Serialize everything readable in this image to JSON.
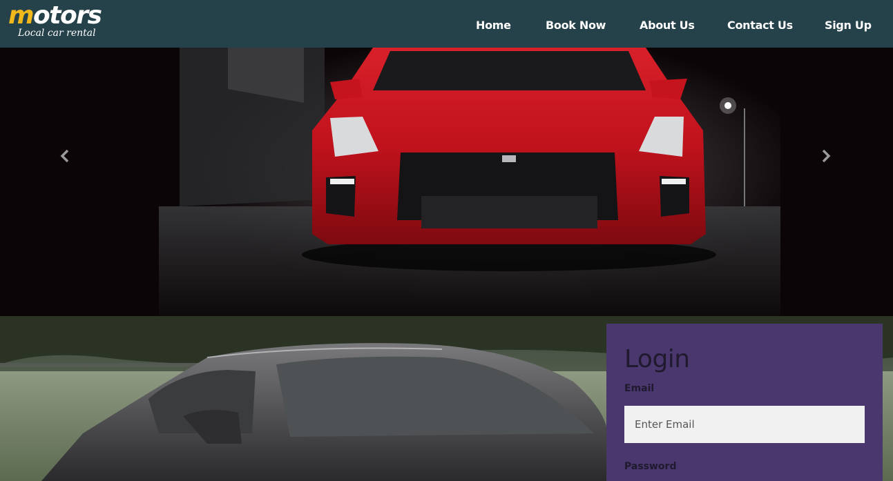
{
  "brand": {
    "name_first_letter": "m",
    "name_rest": "otors",
    "tagline": "Local car rental",
    "colors": {
      "accent": "#f1b81c",
      "navbar": "#25424a",
      "panel": "#49376e"
    }
  },
  "nav": {
    "items": [
      {
        "label": "Home"
      },
      {
        "label": "Book Now"
      },
      {
        "label": "About Us"
      },
      {
        "label": "Contact Us"
      },
      {
        "label": "Sign Up"
      }
    ]
  },
  "carousel": {
    "prev_icon": "chevron-left-icon",
    "next_icon": "chevron-right-icon"
  },
  "login": {
    "title": "Login",
    "email_label": "Email",
    "email_placeholder": "Enter Email",
    "email_value": "",
    "password_label": "Password"
  }
}
